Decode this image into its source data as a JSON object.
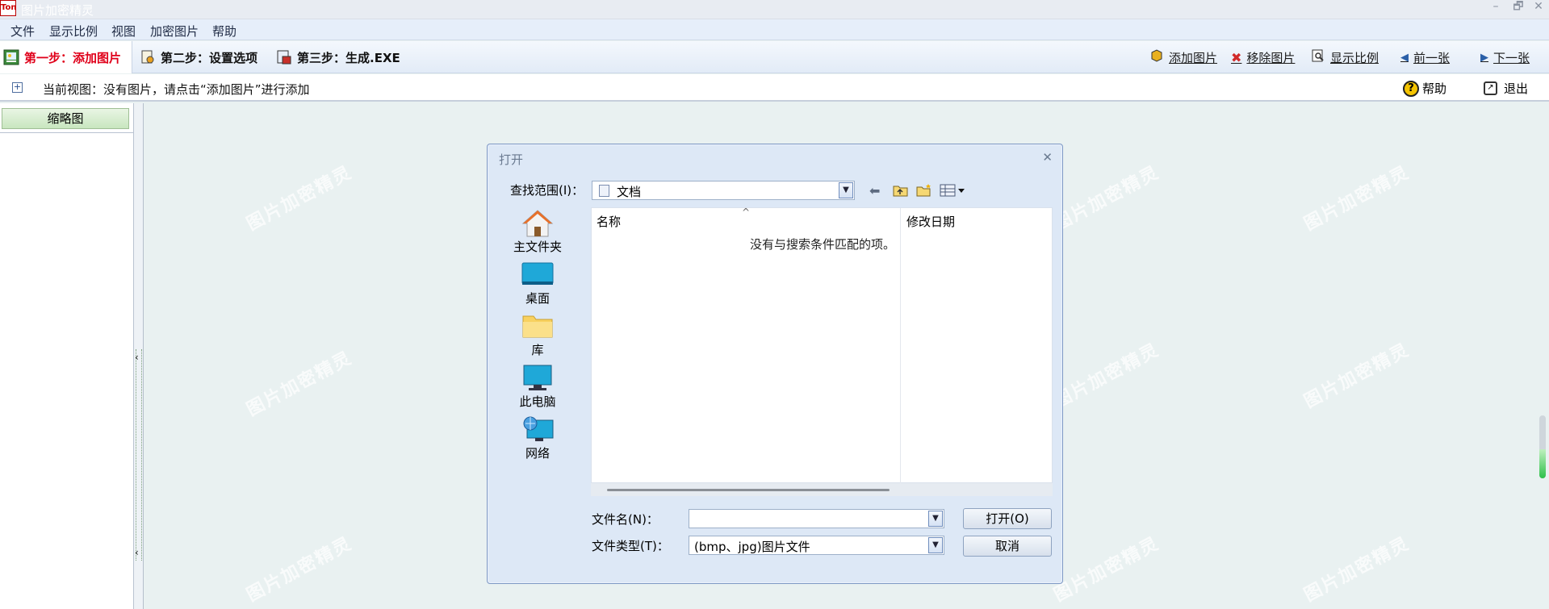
{
  "window": {
    "title": "图片加密精灵",
    "icon_text": "Ton",
    "controls": [
      "–",
      "🗗",
      "✕"
    ]
  },
  "menu": [
    "文件",
    "显示比例",
    "视图",
    "加密图片",
    "帮助"
  ],
  "steps": {
    "step1": "第一步：添加图片",
    "step2": "第二步：设置选项",
    "step3": "第三步：生成.EXE"
  },
  "toolbar": {
    "add": "添加图片",
    "remove": "移除图片",
    "zoom": "显示比例",
    "prev": "前一张",
    "next": "下一张"
  },
  "status": {
    "text": "当前视图：没有图片，请点击“添加图片”进行添加",
    "help": "帮助",
    "exit": "退出"
  },
  "left_panel": {
    "tab": "缩略图"
  },
  "watermark": "图片加密精灵",
  "dialog": {
    "title": "打开",
    "look_in_label": "查找范围(I)：",
    "look_in_value": "文档",
    "places": [
      "主文件夹",
      "桌面",
      "库",
      "此电脑",
      "网络"
    ],
    "columns": {
      "name": "名称",
      "date": "修改日期"
    },
    "empty_message": "没有与搜索条件匹配的项。",
    "filename_label": "文件名(N)：",
    "filename_value": "",
    "filetype_label": "文件类型(T)：",
    "filetype_value": "(bmp、jpg)图片文件",
    "open_button": "打开(O)",
    "cancel_button": "取消"
  },
  "colors": {
    "step1_text": "#e0001a",
    "accent_blue": "#2a5fa8",
    "remove_red": "#d12a2a",
    "scroll_green": "#2ec04a"
  }
}
